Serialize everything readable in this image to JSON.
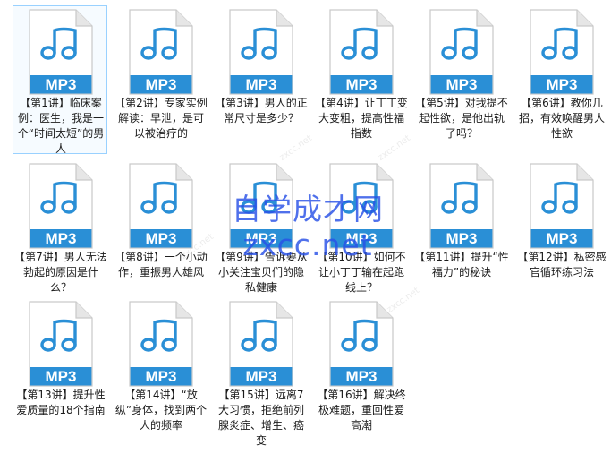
{
  "files": [
    {
      "icon_label": "MP3",
      "caption": "【第1讲】临床案例：医生，我是一个“时间太短”的男人",
      "selected": true
    },
    {
      "icon_label": "MP3",
      "caption": "【第2讲】专家实例解读：早泄，是可以被治疗的"
    },
    {
      "icon_label": "MP3",
      "caption": "【第3讲】男人的正常尺寸是多少？"
    },
    {
      "icon_label": "MP3",
      "caption": "【第4讲】让丁丁变大变粗，提高性福指数"
    },
    {
      "icon_label": "MP3",
      "caption": "【第5讲】对我提不起性欲，是他出轨了吗？"
    },
    {
      "icon_label": "MP3",
      "caption": "【第6讲】教你几招，有效唤醒男人性欲"
    },
    {
      "icon_label": "MP3",
      "caption": "【第7讲】男人无法勃起的原因是什么？"
    },
    {
      "icon_label": "MP3",
      "caption": "【第8讲】一个小动作，重振男人雄风"
    },
    {
      "icon_label": "MP3",
      "caption": "【第9讲】告诉要从小关注宝贝们的隐私健康"
    },
    {
      "icon_label": "MP3",
      "caption": "【第10讲】如何不让小丁丁输在起跑线上？"
    },
    {
      "icon_label": "MP3",
      "caption": "【第11讲】提升“性福力”的秘诀"
    },
    {
      "icon_label": "MP3",
      "caption": "【第12讲】私密感官循环练习法"
    },
    {
      "icon_label": "MP3",
      "caption": "【第13讲】提升性爱质量的18个指南"
    },
    {
      "icon_label": "MP3",
      "caption": "【第14讲】“放纵”身体，找到两个人的频率"
    },
    {
      "icon_label": "MP3",
      "caption": "【第15讲】远离7大习惯，拒绝前列腺炎症、增生、癌变"
    },
    {
      "icon_label": "MP3",
      "caption": "【第16讲】解决终极难题，重回性爱高潮"
    }
  ],
  "watermark": {
    "line1": "自学成才网",
    "line2": "zxcc.net"
  },
  "faint_watermark": "zxcc.net",
  "colors": {
    "file_body": "#ffffff",
    "file_border": "#c9c9c9",
    "fold": "#e6e6e6",
    "note": "#2a8fd6",
    "band": "#2a8fd6",
    "band_text": "#ffffff",
    "selection_border": "#99d1ff"
  }
}
